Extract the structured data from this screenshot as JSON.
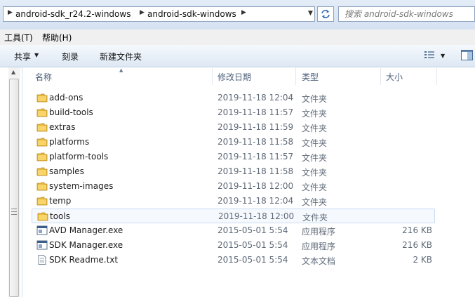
{
  "address": {
    "crumbs": [
      "android-sdk_r24.2-windows",
      "android-sdk-windows"
    ],
    "search_placeholder": "搜索 android-sdk-windows"
  },
  "menu": {
    "items": [
      "工具(T)",
      "帮助(H)"
    ]
  },
  "toolbar": {
    "share": "共享",
    "burn": "刻录",
    "new_folder": "新建文件夹"
  },
  "columns": {
    "name": "名称",
    "modified": "修改日期",
    "type": "类型",
    "size": "大小"
  },
  "files": [
    {
      "name": "add-ons",
      "modified": "2019-11-18 12:04",
      "type": "文件夹",
      "size": "",
      "icon": "folder-icon"
    },
    {
      "name": "build-tools",
      "modified": "2019-11-18 11:57",
      "type": "文件夹",
      "size": "",
      "icon": "folder-icon"
    },
    {
      "name": "extras",
      "modified": "2019-11-18 11:59",
      "type": "文件夹",
      "size": "",
      "icon": "folder-icon"
    },
    {
      "name": "platforms",
      "modified": "2019-11-18 11:58",
      "type": "文件夹",
      "size": "",
      "icon": "folder-icon"
    },
    {
      "name": "platform-tools",
      "modified": "2019-11-18 11:57",
      "type": "文件夹",
      "size": "",
      "icon": "folder-icon"
    },
    {
      "name": "samples",
      "modified": "2019-11-18 11:58",
      "type": "文件夹",
      "size": "",
      "icon": "folder-icon"
    },
    {
      "name": "system-images",
      "modified": "2019-11-18 12:00",
      "type": "文件夹",
      "size": "",
      "icon": "folder-icon"
    },
    {
      "name": "temp",
      "modified": "2019-11-18 12:04",
      "type": "文件夹",
      "size": "",
      "icon": "folder-icon"
    },
    {
      "name": "tools",
      "modified": "2019-11-18 12:00",
      "type": "文件夹",
      "size": "",
      "icon": "folder-icon",
      "selected": true
    },
    {
      "name": "AVD Manager.exe",
      "modified": "2015-05-01 5:54",
      "type": "应用程序",
      "size": "216 KB",
      "icon": "application-icon"
    },
    {
      "name": "SDK Manager.exe",
      "modified": "2015-05-01 5:54",
      "type": "应用程序",
      "size": "216 KB",
      "icon": "application-icon"
    },
    {
      "name": "SDK Readme.txt",
      "modified": "2015-05-01 5:54",
      "type": "文本文档",
      "size": "2 KB",
      "icon": "text-document-icon"
    }
  ],
  "colors": {
    "selection_border": "#c9dcf2",
    "selection_fill": "#f5f9fe",
    "folder": "#e8b93f"
  }
}
